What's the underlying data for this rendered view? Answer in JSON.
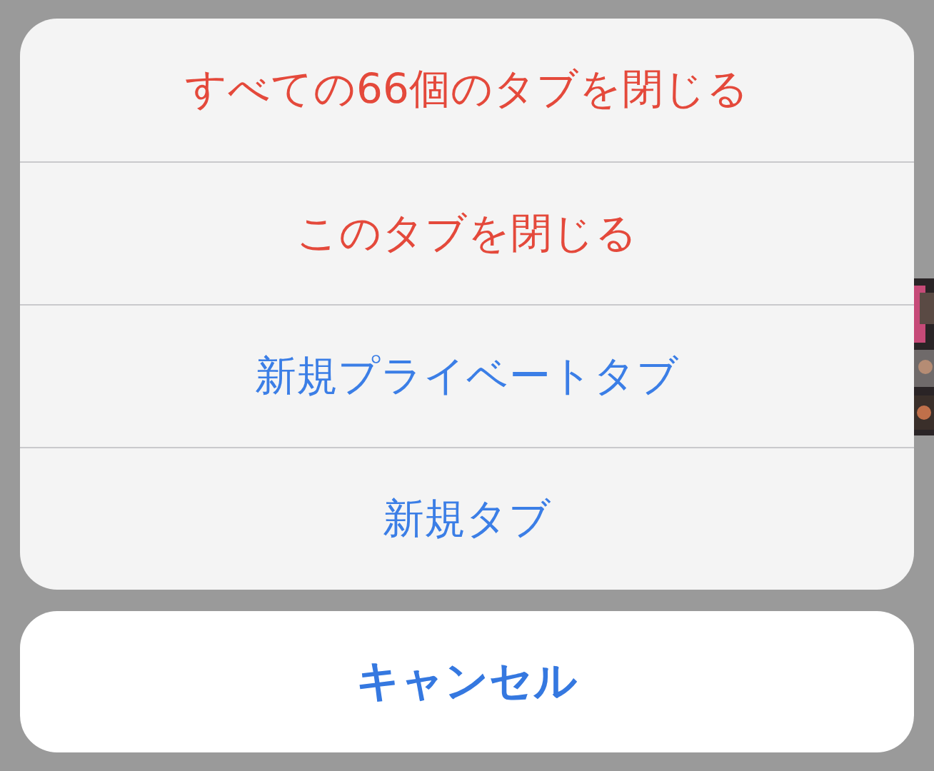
{
  "action_sheet": {
    "actions": [
      {
        "label": "すべての66個のタブを閉じる",
        "kind": "destructive"
      },
      {
        "label": "このタブを閉じる",
        "kind": "destructive"
      },
      {
        "label": "新規プライベートタブ",
        "kind": "default"
      },
      {
        "label": "新規タブ",
        "kind": "default"
      }
    ],
    "cancel": {
      "label": "キャンセル"
    }
  }
}
